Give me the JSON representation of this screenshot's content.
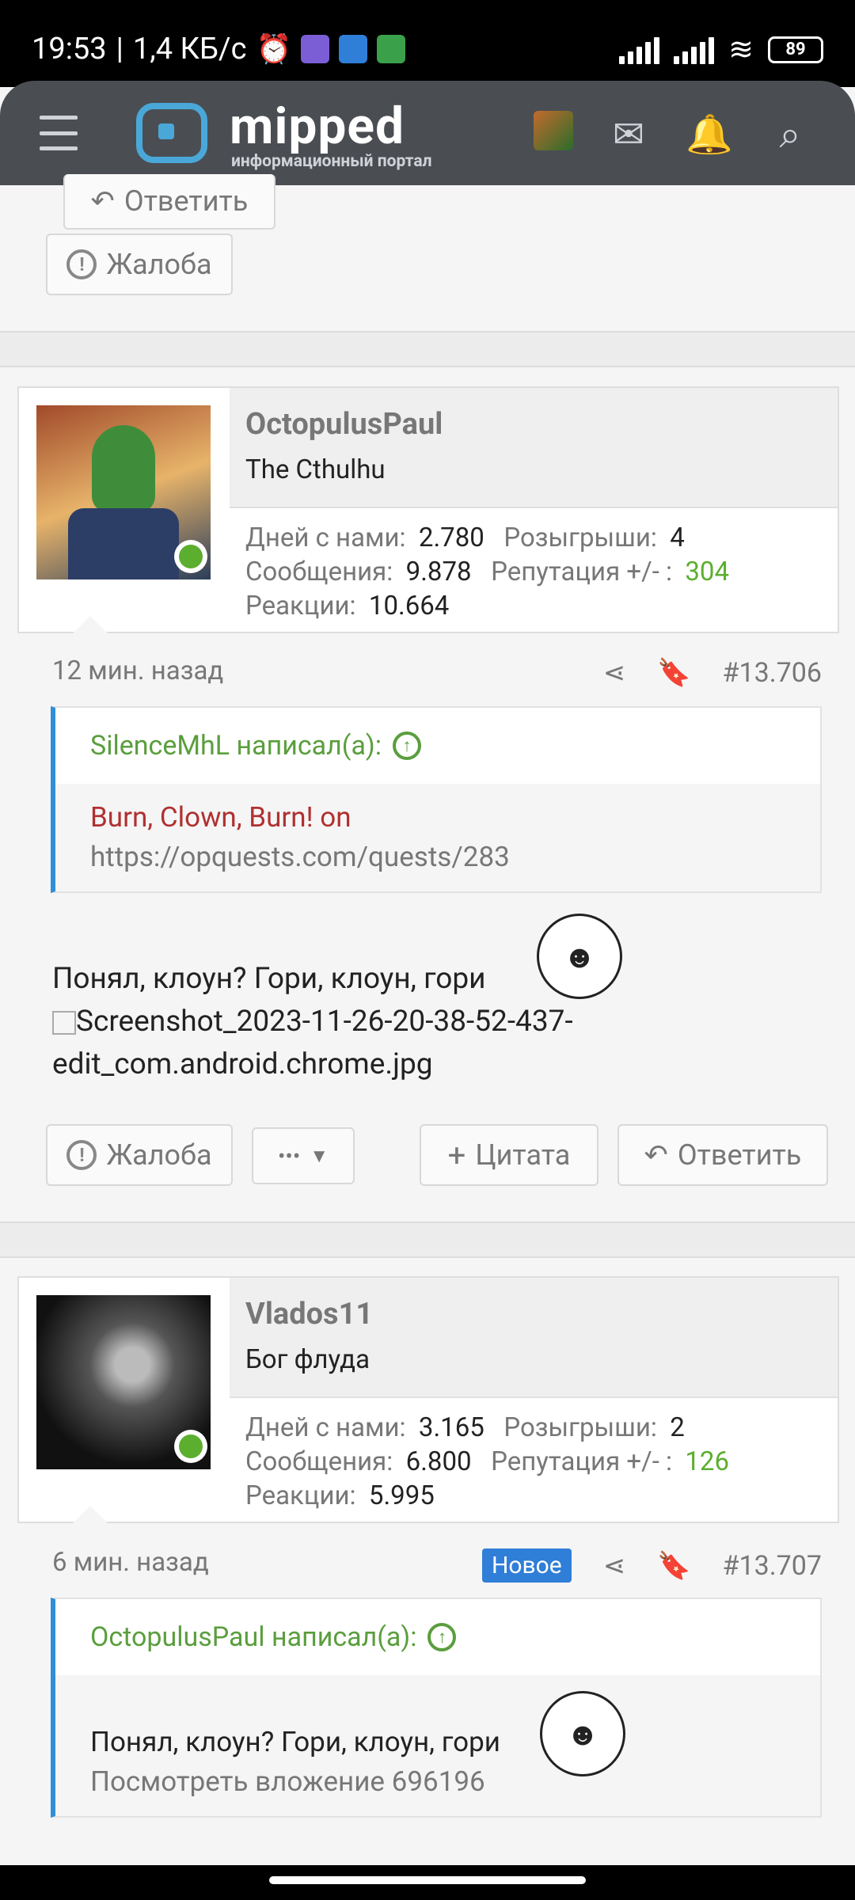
{
  "status": {
    "time": "19:53",
    "speed": "1,4 КБ/с",
    "battery": "89"
  },
  "header": {
    "brand": "mipped",
    "subtitle": "информационный портал"
  },
  "top": {
    "reply": "Ответить",
    "report": "Жалоба"
  },
  "posts": [
    {
      "username": "OctopulusPaul",
      "user_title": "The Cthulhu",
      "stats": {
        "days_label": "Дней с нами:",
        "days": "2.780",
        "giveaways_label": "Розыгрыши:",
        "giveaways": "4",
        "messages_label": "Сообщения:",
        "messages": "9.878",
        "rep_label": "Репутация +/- :",
        "rep": "304",
        "reactions_label": "Реакции:",
        "reactions": "10.664"
      },
      "time": "12 мин. назад",
      "number": "#13.706",
      "quote_author": "SilenceMhL написал(а):",
      "quote_line1": "Burn, Clown, Burn! on",
      "quote_line2": "https://opquests.com/quests/283",
      "text": "Понял, клоун? Гори, клоун, гори",
      "image_alt": "Screenshot_2023-11-26-20-38-52-437-",
      "image_alt2": "edit_com.android.chrome.jpg",
      "actions": {
        "report": "Жалоба",
        "more": "•••",
        "quote": "Цитата",
        "reply": "Ответить"
      }
    },
    {
      "username": "Vlados11",
      "user_title": "Бог флуда",
      "stats": {
        "days_label": "Дней с нами:",
        "days": "3.165",
        "giveaways_label": "Розыгрыши:",
        "giveaways": "2",
        "messages_label": "Сообщения:",
        "messages": "6.800",
        "rep_label": "Репутация +/- :",
        "rep": "126",
        "reactions_label": "Реакции:",
        "reactions": "5.995"
      },
      "time": "6 мин. назад",
      "badge": "Новое",
      "number": "#13.707",
      "quote_author": "OctopulusPaul написал(а):",
      "quote_text": "Понял, клоун? Гори, клоун, гори",
      "quote_attach": "Посмотреть вложение 696196"
    }
  ]
}
